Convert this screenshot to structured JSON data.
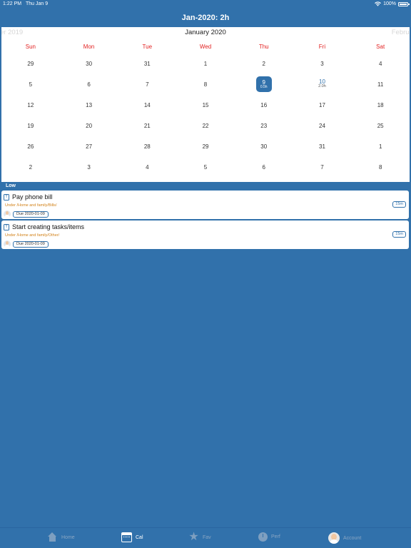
{
  "status_bar": {
    "time": "1:22 PM",
    "date": "Thu Jan 9",
    "battery": "100%"
  },
  "nav": {
    "title": "Jan-2020: 2h"
  },
  "calendar": {
    "prev_month": "er 2019",
    "current_month": "January 2020",
    "next_month": "Februar",
    "weekdays": [
      "Sun",
      "Mon",
      "Tue",
      "Wed",
      "Thu",
      "Fri",
      "Sat"
    ],
    "selected": {
      "day": "9",
      "hours": "0.5h"
    },
    "fri10": {
      "day": "10",
      "hours": "2.0h"
    },
    "weeks": [
      [
        "29",
        "30",
        "31",
        "1",
        "2",
        "3",
        "4"
      ],
      [
        "5",
        "6",
        "7",
        "8",
        "9",
        "10",
        "11"
      ],
      [
        "12",
        "13",
        "14",
        "15",
        "16",
        "17",
        "18"
      ],
      [
        "19",
        "20",
        "21",
        "22",
        "23",
        "24",
        "25"
      ],
      [
        "26",
        "27",
        "28",
        "29",
        "30",
        "31",
        "1"
      ],
      [
        "2",
        "3",
        "4",
        "5",
        "6",
        "7",
        "8"
      ]
    ]
  },
  "section": {
    "label": "Low"
  },
  "tasks": [
    {
      "title": "Pay phone bill",
      "path": "Under /Home and family/Bills/",
      "due": "Due 2020-01-09",
      "duration": "15m",
      "icon": "T"
    },
    {
      "title": "Start creating tasks/items",
      "path": "Under /Home and family/Other/",
      "due": "Due 2020-01-09",
      "duration": "15m",
      "icon": "T"
    }
  ],
  "tabs": [
    {
      "label": "Home",
      "icon": "home-icon"
    },
    {
      "label": "Cal",
      "icon": "calendar-icon"
    },
    {
      "label": "Fav",
      "icon": "star-icon"
    },
    {
      "label": "Perf",
      "icon": "clock-icon"
    },
    {
      "label": "Account",
      "icon": "avatar-icon"
    }
  ],
  "colors": {
    "primary": "#3171ab",
    "weekday": "#e21f1f",
    "path": "#d2821a"
  }
}
